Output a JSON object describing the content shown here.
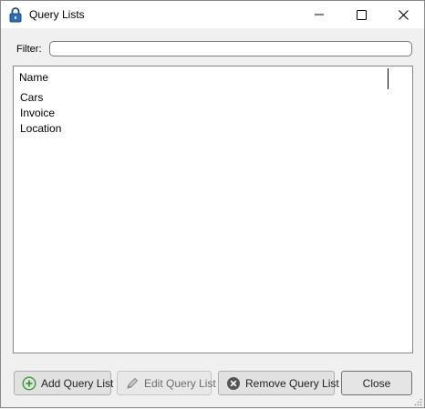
{
  "window": {
    "title": "Query Lists",
    "icon": "lock-icon"
  },
  "filter": {
    "label": "Filter:",
    "value": "",
    "placeholder": ""
  },
  "list": {
    "column_header": "Name",
    "items": [
      {
        "label": "Cars"
      },
      {
        "label": "Invoice"
      },
      {
        "label": "Location"
      }
    ]
  },
  "buttons": {
    "add_label": "Add Query List",
    "edit_label": "Edit Query List",
    "remove_label": "Remove Query List",
    "close_label": "Close"
  },
  "colors": {
    "add_icon": "#3a9a3a",
    "remove_icon": "#555555",
    "title_bar": "#ffffff",
    "client_bg": "#f0f0f0"
  }
}
